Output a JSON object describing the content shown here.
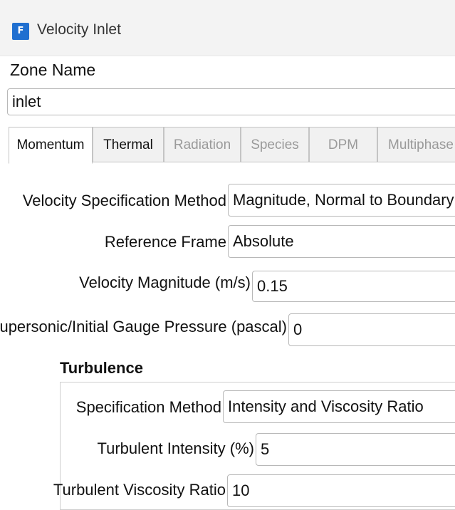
{
  "window": {
    "app_icon_letter": "F",
    "title": "Velocity Inlet"
  },
  "zone": {
    "label": "Zone Name",
    "value": "inlet"
  },
  "tabs": [
    {
      "label": "Momentum",
      "state": "active"
    },
    {
      "label": "Thermal",
      "state": "enabled"
    },
    {
      "label": "Radiation",
      "state": "disabled"
    },
    {
      "label": "Species",
      "state": "disabled"
    },
    {
      "label": "DPM",
      "state": "disabled"
    },
    {
      "label": "Multiphase",
      "state": "disabled"
    }
  ],
  "momentum": {
    "velocity_spec": {
      "label": "Velocity Specification Method",
      "value": "Magnitude, Normal to Boundary"
    },
    "reference_frame": {
      "label": "Reference Frame",
      "value": "Absolute"
    },
    "velocity_magnitude": {
      "label": "Velocity Magnitude (m/s)",
      "value": "0.15"
    },
    "gauge_pressure": {
      "label": "Supersonic/Initial Gauge Pressure (pascal)",
      "value": "0"
    }
  },
  "turbulence": {
    "heading": "Turbulence",
    "spec_method": {
      "label": "Specification Method",
      "value": "Intensity and Viscosity Ratio"
    },
    "intensity": {
      "label": "Turbulent Intensity (%)",
      "value": "5"
    },
    "viscosity_ratio": {
      "label": "Turbulent Viscosity Ratio",
      "value": "10"
    }
  },
  "colors": {
    "app_icon": "#1f6fd0",
    "border": "#b8b8b8",
    "disabled_text": "#9a9a9a"
  }
}
